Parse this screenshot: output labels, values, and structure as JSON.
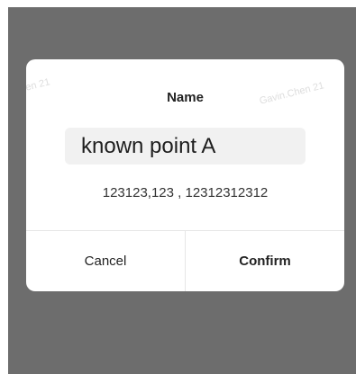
{
  "dialog": {
    "title": "Name",
    "name_value": "known point A",
    "coordinates": "123123,123 , 12312312312",
    "cancel_label": "Cancel",
    "confirm_label": "Confirm"
  },
  "watermark": {
    "text": "Gavin.Chen 21"
  },
  "colors": {
    "overlay": "#6d6d6d",
    "dialog_background": "#ffffff",
    "input_background": "#f1f1f1"
  }
}
